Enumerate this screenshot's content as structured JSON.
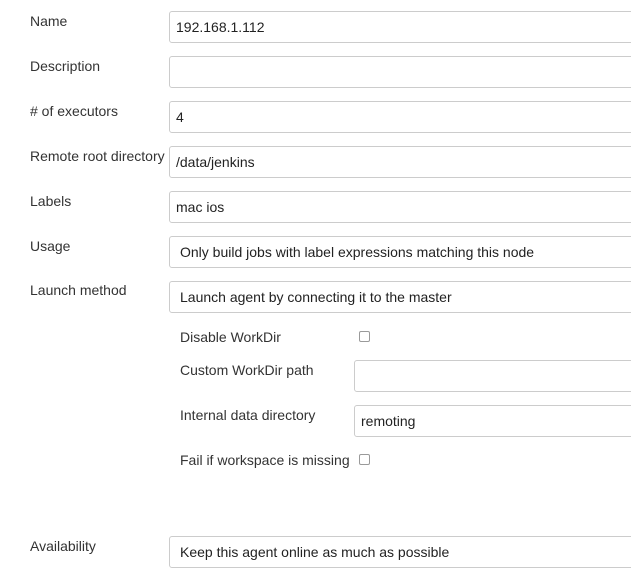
{
  "form": {
    "name": {
      "label": "Name",
      "value": "192.168.1.112"
    },
    "description": {
      "label": "Description",
      "value": ""
    },
    "executors": {
      "label": "# of executors",
      "value": "4"
    },
    "remote_root": {
      "label": "Remote root directory",
      "value": "/data/jenkins"
    },
    "labels": {
      "label": "Labels",
      "value": "mac ios"
    },
    "usage": {
      "label": "Usage",
      "selected": "Only build jobs with label expressions matching this node"
    },
    "launch_method": {
      "label": "Launch method",
      "selected": "Launch agent by connecting it to the master",
      "disable_workdir": {
        "label": "Disable WorkDir",
        "checked": false
      },
      "custom_workdir": {
        "label": "Custom WorkDir path",
        "value": ""
      },
      "internal_data_dir": {
        "label": "Internal data directory",
        "value": "remoting"
      },
      "fail_if_missing": {
        "label": "Fail if workspace is missing",
        "checked": false
      }
    },
    "availability": {
      "label": "Availability",
      "selected": "Keep this agent online as much as possible"
    }
  }
}
